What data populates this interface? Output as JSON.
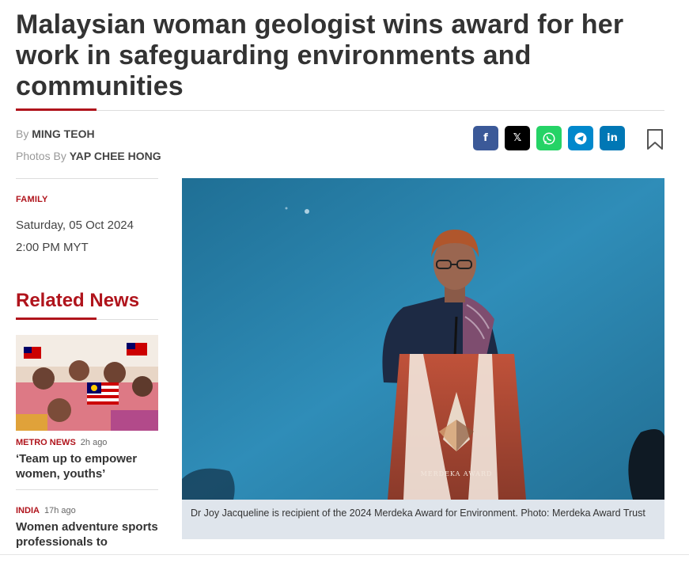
{
  "article": {
    "headline": "Malaysian woman geologist wins award for her work in safeguarding environments and communities",
    "by_prefix": "By",
    "author": "MING TEOH",
    "photos_prefix": "Photos By",
    "photographer": "YAP CHEE HONG",
    "category": "FAMILY",
    "date": "Saturday, 05 Oct 2024",
    "time": "2:00 PM MYT",
    "caption": "Dr Joy Jacqueline is recipient of the 2024 Merdeka Award for Environment. Photo: Merdeka Award Trust",
    "podium_text": "MERDEKA AWARD"
  },
  "share": {
    "buttons": [
      {
        "name": "facebook",
        "glyph": "f",
        "color": "#3b5998"
      },
      {
        "name": "x",
        "glyph": "𝕏",
        "color": "#000000"
      },
      {
        "name": "whatsapp",
        "glyph": "✆",
        "color": "#25d366"
      },
      {
        "name": "telegram",
        "glyph": "➤",
        "color": "#0088cc"
      },
      {
        "name": "linkedin",
        "glyph": "in",
        "color": "#0077b5"
      }
    ]
  },
  "related": {
    "title": "Related News",
    "items": [
      {
        "category": "METRO NEWS",
        "ago": "2h ago",
        "headline": "‘Team up to empower women, youths’"
      },
      {
        "category": "INDIA",
        "ago": "17h ago",
        "headline": "Women adventure sports professionals to"
      }
    ]
  },
  "colors": {
    "accent": "#b0141c"
  }
}
